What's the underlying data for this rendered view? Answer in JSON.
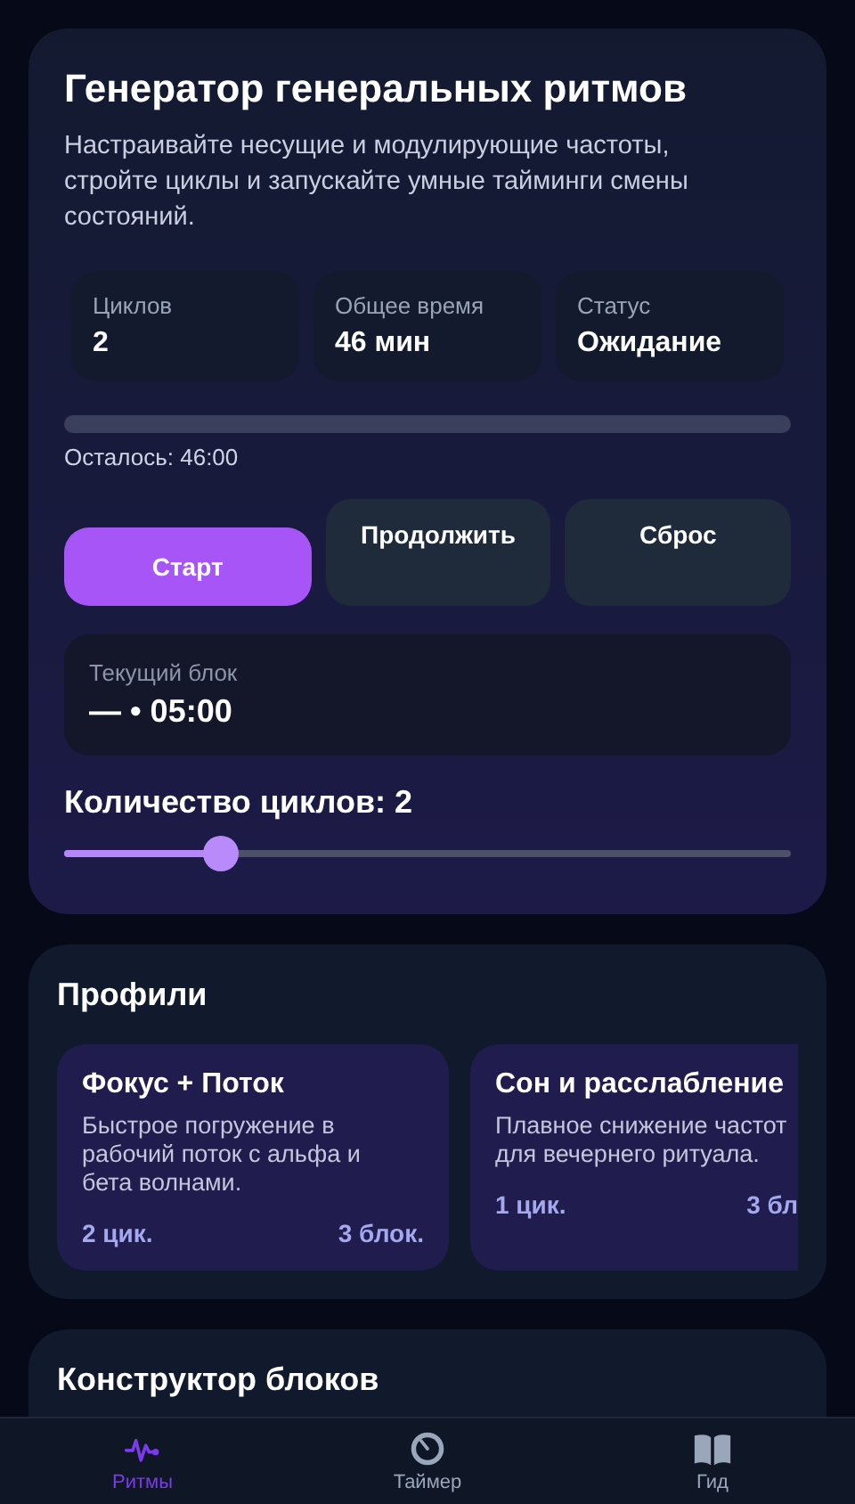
{
  "header": {
    "title": "Генератор генеральных ритмов",
    "description": "Настраивайте несущие и модулирующие частоты, стройте циклы и запускайте умные тайминги смены состояний."
  },
  "stats": [
    {
      "label": "Циклов",
      "value": "2"
    },
    {
      "label": "Общее время",
      "value": "46 мин"
    },
    {
      "label": "Статус",
      "value": "Ожидание"
    }
  ],
  "progress": {
    "remaining": "Осталось: 46:00"
  },
  "buttons": [
    {
      "label": "Старт",
      "kind": "primary"
    },
    {
      "label": "Продолжить",
      "kind": "secondary"
    },
    {
      "label": "Сброс",
      "kind": "secondary"
    }
  ],
  "current_block": {
    "label": "Текущий блок",
    "value": "— • 05:00"
  },
  "cycles_slider": {
    "label": "Количество циклов: 2",
    "level": 0.215
  },
  "profiles": {
    "title": "Профили",
    "items": [
      {
        "name": "Фокус + Поток",
        "description": "Быстрое погружение в рабочий поток с альфа и бета волнами.",
        "cycles": "2 цик.",
        "blocks": "3 блок."
      },
      {
        "name": "Сон и расслабление",
        "description": "Плавное снижение частот для вечернего ритуала.",
        "cycles": "1 цик.",
        "blocks": "3 бл"
      }
    ]
  },
  "builder": {
    "title": "Конструктор блоков"
  },
  "tabs": [
    {
      "label": "Ритмы",
      "selected": true
    },
    {
      "label": "Таймер",
      "selected": false
    },
    {
      "label": "Гид",
      "selected": false
    }
  ]
}
